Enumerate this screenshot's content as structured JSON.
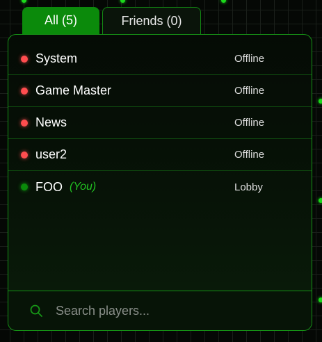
{
  "tabs": {
    "all_label": "All (5)",
    "friends_label": "Friends (0)"
  },
  "players": [
    {
      "name": "System",
      "status": "Offline",
      "online": false,
      "you": ""
    },
    {
      "name": "Game Master",
      "status": "Offline",
      "online": false,
      "you": ""
    },
    {
      "name": "News",
      "status": "Offline",
      "online": false,
      "you": ""
    },
    {
      "name": "user2",
      "status": "Offline",
      "online": false,
      "you": ""
    },
    {
      "name": "FOO",
      "status": "Lobby",
      "online": true,
      "you": "(You)"
    }
  ],
  "search": {
    "placeholder": "Search players..."
  },
  "colors": {
    "accent": "#0b8a0b",
    "border": "#169616",
    "offline": "#ff4d4f",
    "online": "#0a8a0a",
    "you_tag": "#22c322"
  },
  "icons": {
    "search": "search-icon",
    "status": "status-dot-icon"
  }
}
